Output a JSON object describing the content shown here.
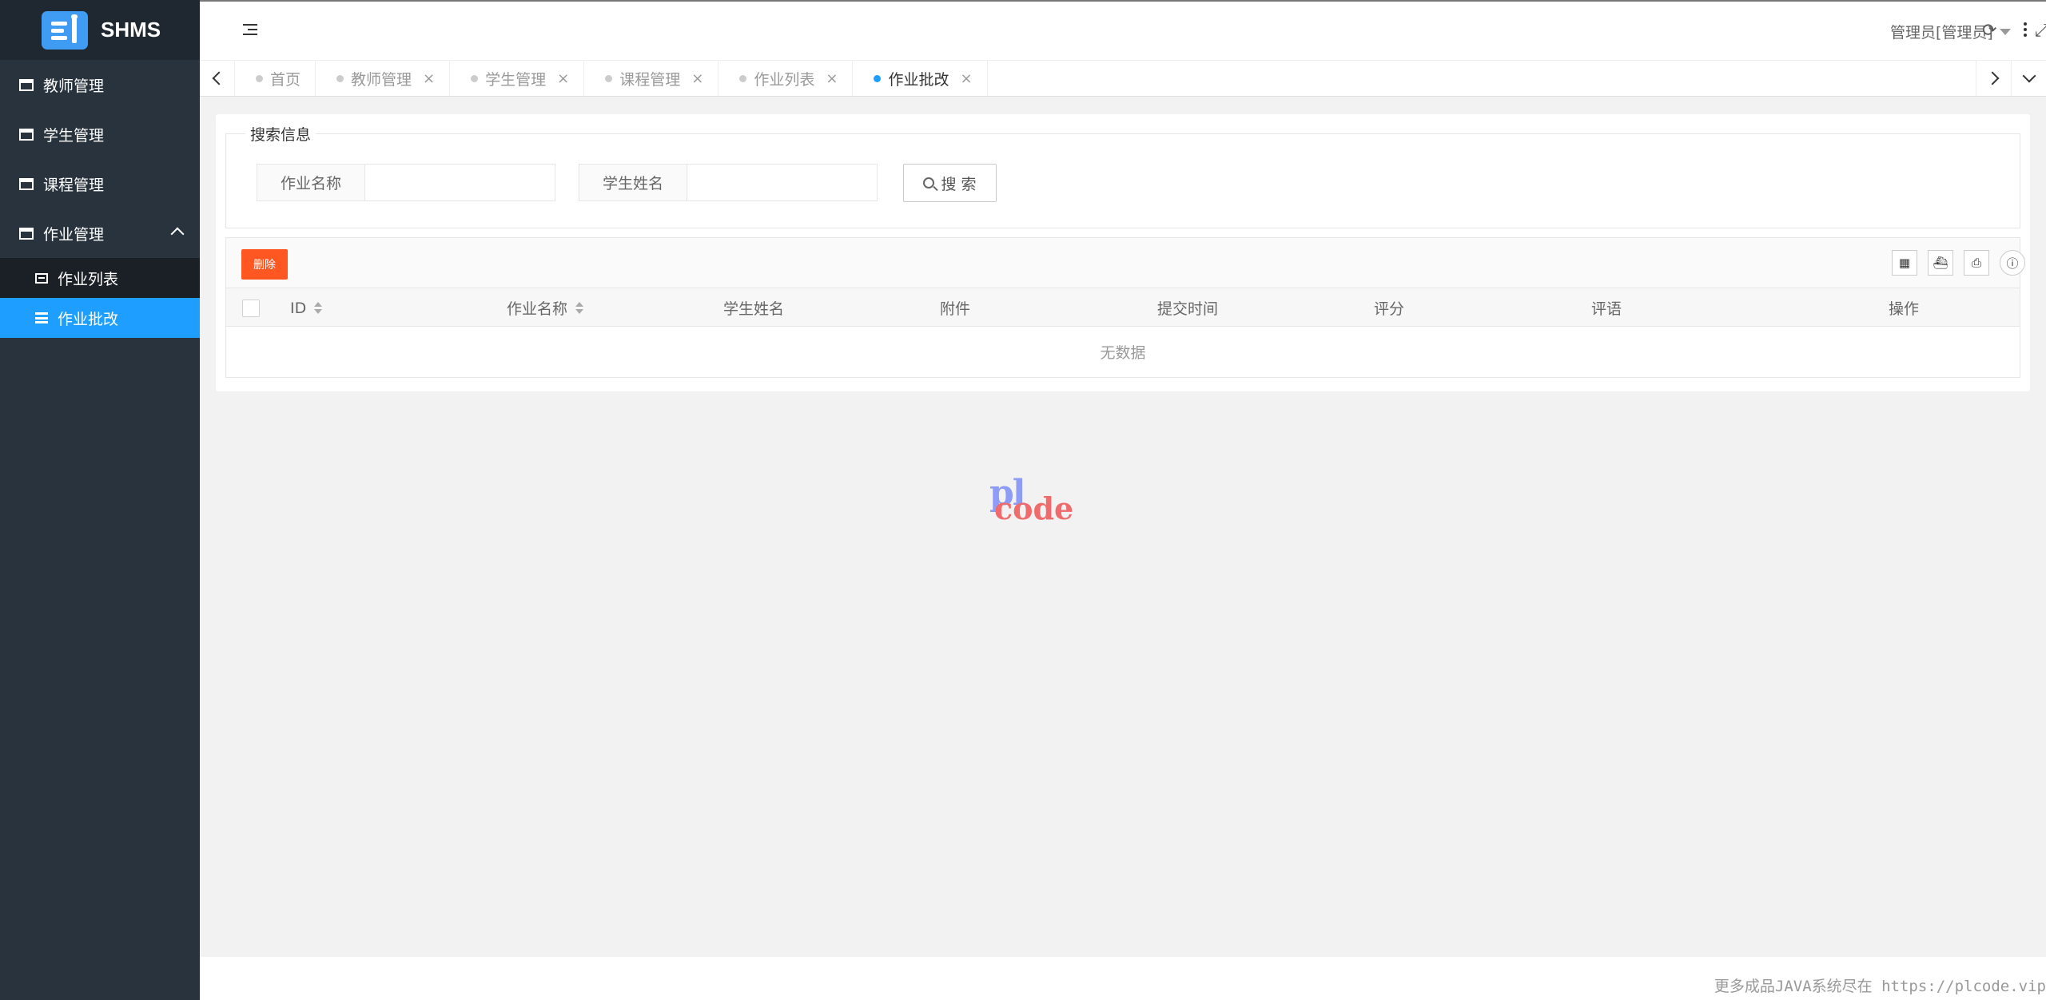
{
  "app": {
    "name": "SHMS"
  },
  "sidebar": {
    "items": [
      {
        "label": "教师管理"
      },
      {
        "label": "学生管理"
      },
      {
        "label": "课程管理"
      },
      {
        "label": "作业管理"
      }
    ],
    "sub_items": [
      {
        "label": "作业列表"
      },
      {
        "label": "作业批改"
      }
    ]
  },
  "header": {
    "user": "管理员[管理员]"
  },
  "tabs": [
    {
      "label": "首页"
    },
    {
      "label": "教师管理"
    },
    {
      "label": "学生管理"
    },
    {
      "label": "课程管理"
    },
    {
      "label": "作业列表"
    },
    {
      "label": "作业批改"
    }
  ],
  "search": {
    "legend": "搜索信息",
    "homework_label": "作业名称",
    "homework_value": "",
    "student_label": "学生姓名",
    "student_value": "",
    "button": "搜 索"
  },
  "toolbar": {
    "delete": "删除"
  },
  "table": {
    "columns": [
      "ID",
      "作业名称",
      "学生姓名",
      "附件",
      "提交时间",
      "评分",
      "评语",
      "操作"
    ],
    "empty": "无数据"
  },
  "watermark": {
    "top": "pl",
    "bottom": "code"
  },
  "footer": {
    "text": "更多成品JAVA系统尽在 https://plcode.vip"
  },
  "colors": {
    "sidebar": "#28333e",
    "active": "#1e9fff",
    "danger": "#ff5722"
  }
}
